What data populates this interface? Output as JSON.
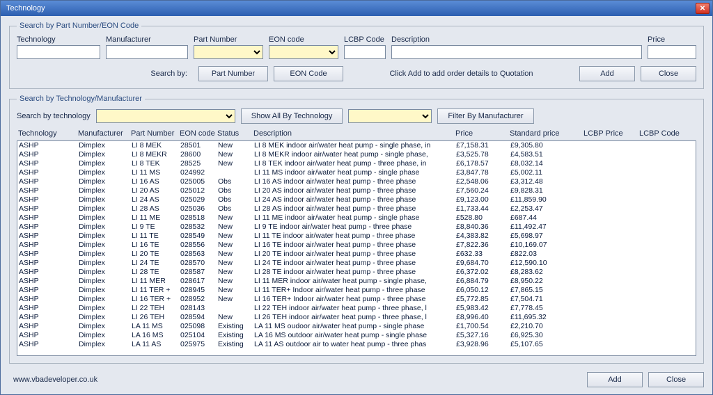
{
  "window": {
    "title": "Technology"
  },
  "group1": {
    "legend": "Search by Part Number/EON Code",
    "labels": {
      "technology": "Technology",
      "manufacturer": "Manufacturer",
      "partNumber": "Part Number",
      "eonCode": "EON code",
      "lcbpCode": "LCBP Code",
      "description": "Description",
      "price": "Price"
    },
    "values": {
      "technology": "",
      "manufacturer": "",
      "partNumber": "",
      "eonCode": "",
      "lcbpCode": "",
      "description": "",
      "price": ""
    },
    "searchByLabel": "Search by:",
    "buttons": {
      "partNumber": "Part Number",
      "eonCode": "EON Code",
      "add": "Add",
      "close": "Close"
    },
    "hint": "Click Add to add order details to Quotation"
  },
  "group2": {
    "legend": "Search by Technology/Manufacturer",
    "labels": {
      "searchByTechnology": "Search by technology"
    },
    "buttons": {
      "showAll": "Show All By Technology",
      "filter": "Filter By Manufacturer"
    },
    "columns": {
      "technology": "Technology",
      "manufacturer": "Manufacturer",
      "partNumber": "Part Number",
      "eonCode": "EON code",
      "status": "Status",
      "description": "Description",
      "price": "Price",
      "standardPrice": "Standard price",
      "lcbpPrice": "LCBP Price",
      "lcbpCode": "LCBP Code"
    },
    "rows": [
      {
        "tech": "ASHP",
        "manu": "Dimplex",
        "part": "LI 8 MEK",
        "eon": "28501",
        "status": "New",
        "desc": "LI 8 MEK indoor air/water heat pump - single phase, in",
        "price": "£7,158.31",
        "std": "£9,305.80"
      },
      {
        "tech": "ASHP",
        "manu": "Dimplex",
        "part": "LI 8 MEKR",
        "eon": "28600",
        "status": "New",
        "desc": "LI 8 MEKR indoor air/water heat pump - single phase,",
        "price": "£3,525.78",
        "std": "£4,583.51"
      },
      {
        "tech": "ASHP",
        "manu": "Dimplex",
        "part": "LI 8 TEK",
        "eon": "28525",
        "status": "New",
        "desc": "LI 8 TEK indoor air/water heat pump - three phase, in",
        "price": "£6,178.57",
        "std": "£8,032.14"
      },
      {
        "tech": "ASHP",
        "manu": "Dimplex",
        "part": "LI 11 MS",
        "eon": "024992",
        "status": "",
        "desc": "LI 11 MS indoor air/water heat pump - single phase",
        "price": "£3,847.78",
        "std": "£5,002.11"
      },
      {
        "tech": "ASHP",
        "manu": "Dimplex",
        "part": "LI 16 AS",
        "eon": "025005",
        "status": "Obs",
        "desc": "LI 16 AS indoor air/water heat pump - three phase",
        "price": "£2,548.06",
        "std": "£3,312.48"
      },
      {
        "tech": "ASHP",
        "manu": "Dimplex",
        "part": "LI 20 AS",
        "eon": "025012",
        "status": "Obs",
        "desc": "LI 20 AS indoor air/water heat pump - three phase",
        "price": "£7,560.24",
        "std": "£9,828.31"
      },
      {
        "tech": "ASHP",
        "manu": "Dimplex",
        "part": "LI 24 AS",
        "eon": "025029",
        "status": "Obs",
        "desc": "LI 24 AS indoor air/water heat pump - three phase",
        "price": "£9,123.00",
        "std": "£11,859.90"
      },
      {
        "tech": "ASHP",
        "manu": "Dimplex",
        "part": "LI 28 AS",
        "eon": "025036",
        "status": "Obs",
        "desc": "LI 28 AS indoor air/water heat pump - three phase",
        "price": "£1,733.44",
        "std": "£2,253.47"
      },
      {
        "tech": "ASHP",
        "manu": "Dimplex",
        "part": "LI 11 ME",
        "eon": "028518",
        "status": "New",
        "desc": "LI 11 ME indoor air/water heat pump - single phase",
        "price": "£528.80",
        "std": "£687.44"
      },
      {
        "tech": "ASHP",
        "manu": "Dimplex",
        "part": "LI 9 TE",
        "eon": "028532",
        "status": "New",
        "desc": "LI 9 TE indoor air/water heat pump - three phase",
        "price": "£8,840.36",
        "std": "£11,492.47"
      },
      {
        "tech": "ASHP",
        "manu": "Dimplex",
        "part": "LI 11 TE",
        "eon": "028549",
        "status": "New",
        "desc": "LI 11 TE indoor air/water heat pump - three phase",
        "price": "£4,383.82",
        "std": "£5,698.97"
      },
      {
        "tech": "ASHP",
        "manu": "Dimplex",
        "part": "LI 16 TE",
        "eon": "028556",
        "status": "New",
        "desc": "LI 16 TE indoor air/water heat pump - three phase",
        "price": "£7,822.36",
        "std": "£10,169.07"
      },
      {
        "tech": "ASHP",
        "manu": "Dimplex",
        "part": "LI 20 TE",
        "eon": "028563",
        "status": "New",
        "desc": "LI 20 TE indoor air/water heat pump - three phase",
        "price": "£632.33",
        "std": "£822.03"
      },
      {
        "tech": "ASHP",
        "manu": "Dimplex",
        "part": "LI 24 TE",
        "eon": "028570",
        "status": "New",
        "desc": "LI 24 TE indoor air/water heat pump - three phase",
        "price": "£9,684.70",
        "std": "£12,590.10"
      },
      {
        "tech": "ASHP",
        "manu": "Dimplex",
        "part": "LI 28 TE",
        "eon": "028587",
        "status": "New",
        "desc": "LI 28 TE indoor air/water heat pump - three phase",
        "price": "£6,372.02",
        "std": "£8,283.62"
      },
      {
        "tech": "ASHP",
        "manu": "Dimplex",
        "part": "LI 11 MER",
        "eon": "028617",
        "status": "New",
        "desc": "LI 11 MER indoor air/water heat pump - single phase,",
        "price": "£6,884.79",
        "std": "£8,950.22"
      },
      {
        "tech": "ASHP",
        "manu": "Dimplex",
        "part": "LI 11 TER +",
        "eon": "028945",
        "status": "New",
        "desc": "LI 11 TER+ Indoor air/water heat pump - three phase",
        "price": "£6,050.12",
        "std": "£7,865.15"
      },
      {
        "tech": "ASHP",
        "manu": "Dimplex",
        "part": "LI 16 TER +",
        "eon": "028952",
        "status": "New",
        "desc": "LI 16 TER+ Indoor air/water heat pump - three phase",
        "price": "£5,772.85",
        "std": "£7,504.71"
      },
      {
        "tech": "ASHP",
        "manu": "Dimplex",
        "part": "LI 22 TEH",
        "eon": "028143",
        "status": "",
        "desc": "LI 22 TEH indoor air/water heat pump - three phase, l",
        "price": "£5,983.42",
        "std": "£7,778.45"
      },
      {
        "tech": "ASHP",
        "manu": "Dimplex",
        "part": "LI 26 TEH",
        "eon": "028594",
        "status": "New",
        "desc": "LI 26 TEH indoor air/water heat pump - three phase, l",
        "price": "£8,996.40",
        "std": "£11,695.32"
      },
      {
        "tech": "ASHP",
        "manu": "Dimplex",
        "part": "LA 11 MS",
        "eon": "025098",
        "status": "Existing",
        "desc": "LA 11 MS oudoor air/water heat pump - single phase",
        "price": "£1,700.54",
        "std": "£2,210.70"
      },
      {
        "tech": "ASHP",
        "manu": "Dimplex",
        "part": "LA 16 MS",
        "eon": "025104",
        "status": "Existing",
        "desc": "LA 16 MS outdoor air/water heat pump - single phase",
        "price": "£5,327.16",
        "std": "£6,925.30"
      },
      {
        "tech": "ASHP",
        "manu": "Dimplex",
        "part": "LA 11 AS",
        "eon": "025975",
        "status": "Existing",
        "desc": "LA 11 AS outdoor air to water heat pump - three phas",
        "price": "£3,928.96",
        "std": "£5,107.65"
      }
    ]
  },
  "footer": {
    "url": "www.vbadeveloper.co.uk",
    "buttons": {
      "add": "Add",
      "close": "Close"
    }
  }
}
